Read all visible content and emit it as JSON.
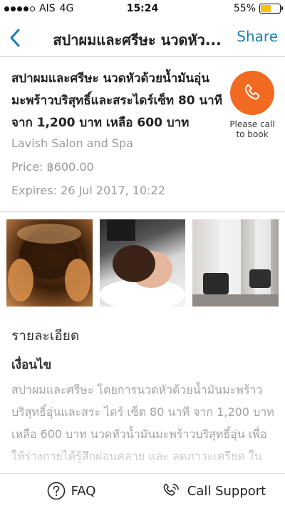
{
  "status_bar": {
    "carrier": "AIS",
    "network": "4G",
    "time": "15:24",
    "battery_text": "55%",
    "battery_level": 0.55,
    "signal_bars_filled": 4,
    "signal_bars_total": 5,
    "battery_color": "#f5c400"
  },
  "nav": {
    "title": "สปาผมและศรีษะ นวดหัว...",
    "share_label": "Share",
    "back_icon": "chevron-left-icon",
    "accent_color": "#1b7fb0"
  },
  "deal": {
    "title": "สปาผมและศรีษะ นวดหัวด้วยน้ำมันอุ่นมะพร้าวบริสุทธิ์และสระไดร์เซ็ท 80 นาที จาก 1,200 บาท เหลือ 600 บาท",
    "merchant": "Lavish Salon and Spa",
    "price": "Price: ฿600.00",
    "expires": "Expires: 26 Jul 2017, 10:22",
    "call_to_book": {
      "label": "Please call to book",
      "icon": "phone-icon",
      "color": "#f26a21"
    }
  },
  "gallery": {
    "photos": [
      {
        "alt": "head-massage-photo"
      },
      {
        "alt": "hair-wash-photo"
      },
      {
        "alt": "salon-interior-photo"
      }
    ]
  },
  "details": {
    "heading": "รายละเอียด",
    "conditions_heading": "เงื่อนไข",
    "body": "สปาผมและศรีษะ โดยการนวดหัวด้วยน้ำมันมะพร้าวบริสุทธิ์อุ่นและสระ ไดร์ เซ็ต 80 นาที จาก 1,200 บาท เหลือ 600 บาท นวดหัวน้ำมันมะพร้าวบริสุทธิ์อุ่น เพื่อให้ร่างกายได้รู้สึกผ่อนคลาย และ ลดภาวะเครียด ในช่วงเวลาเร่งรีบ"
  },
  "bottom_bar": {
    "faq_label": "FAQ",
    "faq_icon": "question-circle-icon",
    "support_label": "Call Support",
    "support_icon": "phone-support-icon"
  }
}
